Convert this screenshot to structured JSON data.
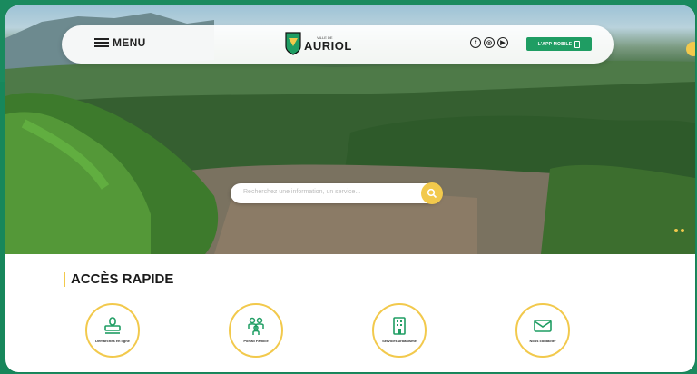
{
  "header": {
    "menu_label": "MENU",
    "logo_small": "VILLE DE",
    "logo_name": "AURIOL",
    "socials": [
      {
        "icon": "facebook-icon",
        "glyph": "f"
      },
      {
        "icon": "instagram-icon",
        "glyph": "◎"
      },
      {
        "icon": "youtube-icon",
        "glyph": "▶"
      }
    ],
    "app_button_label": "L'APP MOBILE"
  },
  "search": {
    "placeholder": "Recherchez une information, un service..."
  },
  "quick_access": {
    "title": "ACCÈS RAPIDE",
    "items": [
      {
        "label": "Démarches en ligne",
        "icon": "stamp-icon"
      },
      {
        "label": "Portail Famille",
        "icon": "family-icon"
      },
      {
        "label": "Services urbanisme",
        "icon": "building-icon"
      },
      {
        "label": "Nous contacter",
        "icon": "envelope-icon"
      }
    ]
  },
  "colors": {
    "brand_green": "#1f9d63",
    "accent_yellow": "#f2c94c",
    "frame_green": "#1a8a5e"
  }
}
